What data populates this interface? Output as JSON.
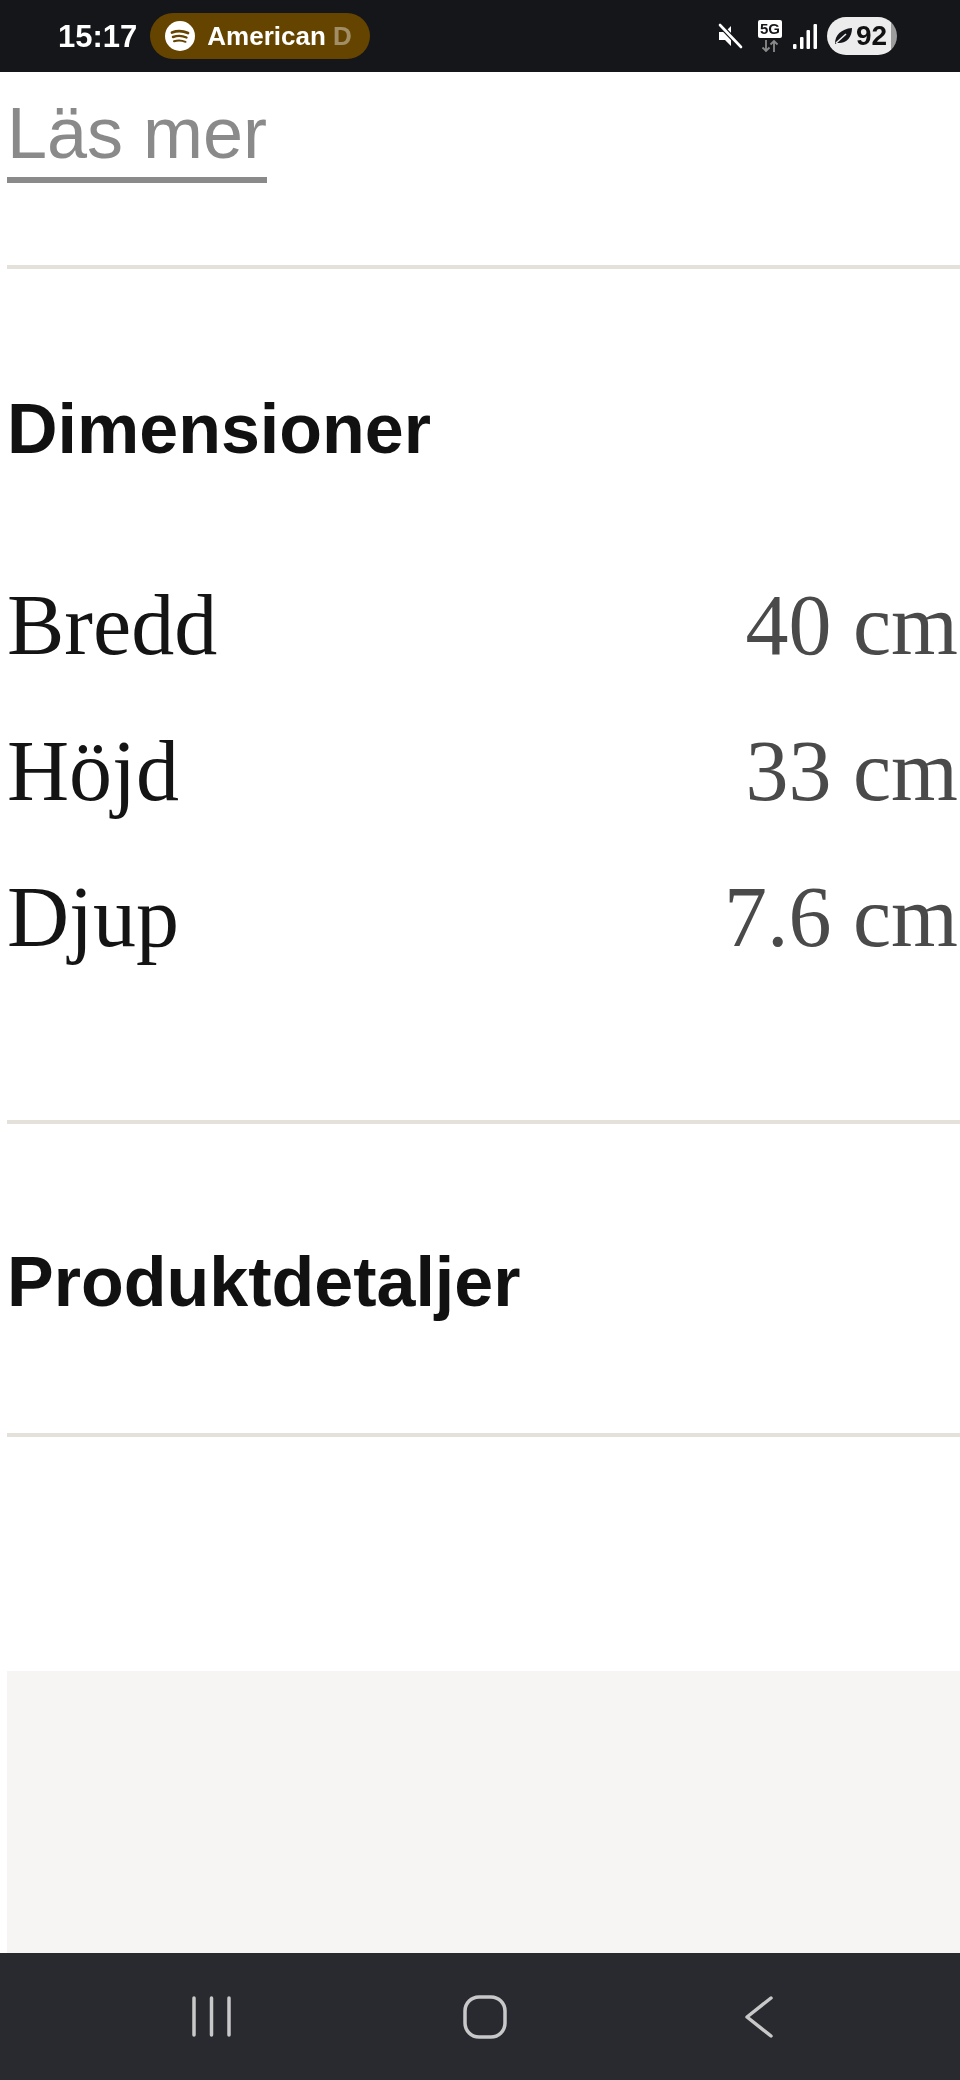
{
  "status_bar": {
    "time": "15:17",
    "media_title": "American D",
    "network_type": "5G",
    "battery": "92"
  },
  "read_more_link": "Läs mer",
  "sections": [
    {
      "kind": "spec_table",
      "title": "Dimensioner",
      "rows": [
        {
          "label": "Bredd",
          "value": "40 cm"
        },
        {
          "label": "Höjd",
          "value": "33 cm"
        },
        {
          "label": "Djup",
          "value": "7.6 cm"
        }
      ]
    },
    {
      "kind": "collapsed",
      "title": "Produktdetaljer"
    }
  ]
}
